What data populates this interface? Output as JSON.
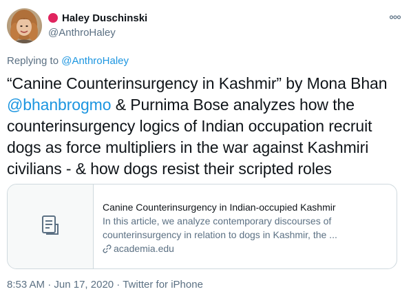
{
  "author": {
    "display_name": "Haley Duschinski",
    "handle": "@AnthroHaley",
    "avatar_icon": "user-avatar-photo",
    "badge_color": "#e0245e"
  },
  "more_icon": "more-options-icon",
  "reply": {
    "prefix": "Replying to ",
    "handle": "@AnthroHaley"
  },
  "text": {
    "part1": "“Canine Counterinsurgency in Kashmir” by Mona Bhan ",
    "mention": "@bhanbrogmo",
    "part2": " & Purnima Bose analyzes how the counterinsurgency logics of Indian occupation recruit dogs as force multipliers in the war against Kashmiri civilians - & how dogs resist their scripted roles"
  },
  "card": {
    "title": "Canine Counterinsurgency in Indian-occupied Kashmir",
    "description_line1": "In this article, we analyze contemporary discourses of",
    "description_line2": "counterinsurgency in relation to dogs in Kashmir, the ...",
    "domain": "academia.edu",
    "media_icon": "document-icon"
  },
  "meta": {
    "time": "8:53 AM",
    "sep1": " · ",
    "date": "Jun 17, 2020",
    "sep2": " · ",
    "source": "Twitter for iPhone"
  },
  "colors": {
    "link": "#1b95e0",
    "secondary_text": "#5b7083",
    "border": "#cfd9de"
  }
}
